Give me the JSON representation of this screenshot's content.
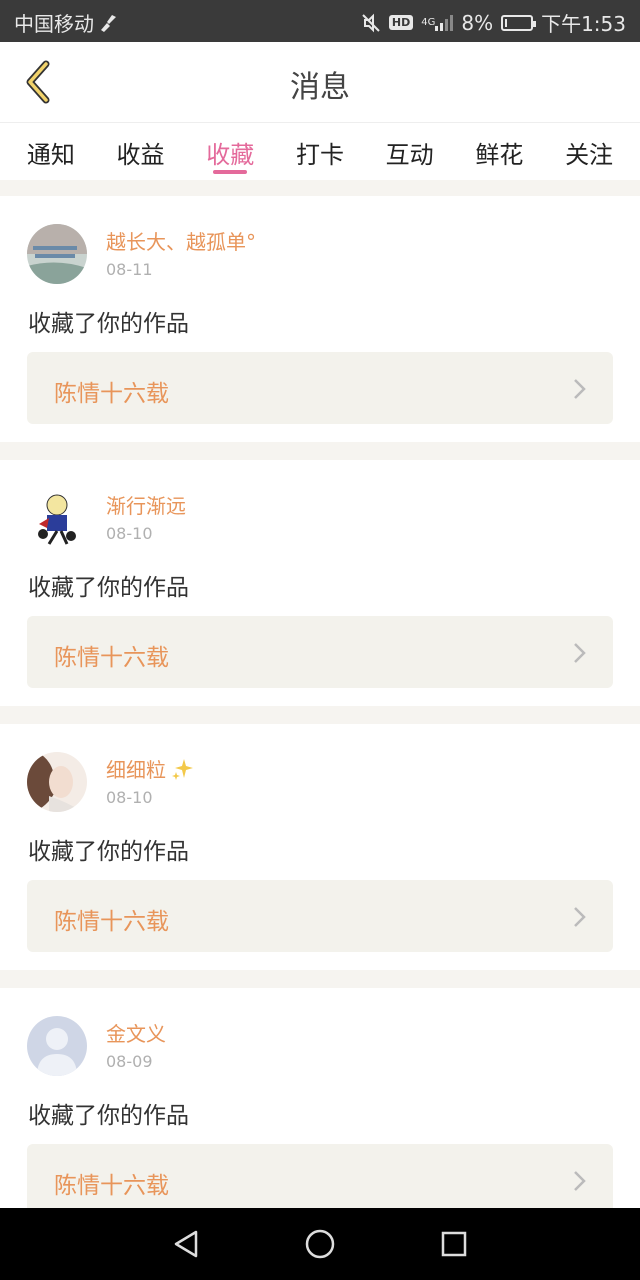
{
  "status_bar": {
    "carrier": "中国移动",
    "battery": "8%",
    "time": "下午1:53",
    "hd_label": "HD",
    "net_label": "4G",
    "battery_level": 0.08
  },
  "nav": {
    "title": "消息"
  },
  "tabs": [
    {
      "label": "通知"
    },
    {
      "label": "收益"
    },
    {
      "label": "收藏",
      "active": true
    },
    {
      "label": "打卡"
    },
    {
      "label": "互动"
    },
    {
      "label": "鲜花"
    },
    {
      "label": "关注"
    }
  ],
  "items": [
    {
      "user": "越长大、越孤单°",
      "date": "08-11",
      "action": "收藏了你的作品",
      "work": "陈情十六载"
    },
    {
      "user": "渐行渐远",
      "date": "08-10",
      "action": "收藏了你的作品",
      "work": "陈情十六载"
    },
    {
      "user": "细细粒",
      "date": "08-10",
      "action": "收藏了你的作品",
      "work": "陈情十六载"
    },
    {
      "user": "金文义",
      "date": "08-09",
      "action": "收藏了你的作品",
      "work": "陈情十六载"
    }
  ],
  "colors": {
    "accent": "#e46a9b",
    "username": "#e8955a"
  }
}
